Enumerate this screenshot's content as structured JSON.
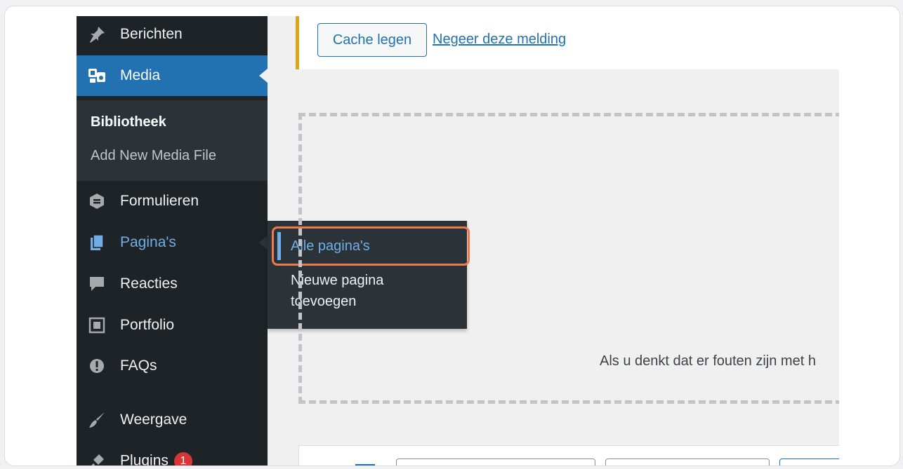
{
  "sidebar": {
    "items": [
      {
        "label": "Berichten",
        "icon": "pin-icon"
      },
      {
        "label": "Media",
        "icon": "media-icon"
      },
      {
        "label": "Formulieren",
        "icon": "forms-icon"
      },
      {
        "label": "Pagina's",
        "icon": "pages-icon"
      },
      {
        "label": "Reacties",
        "icon": "comment-icon"
      },
      {
        "label": "Portfolio",
        "icon": "portfolio-icon"
      },
      {
        "label": "FAQs",
        "icon": "info-icon"
      },
      {
        "label": "Weergave",
        "icon": "brush-icon"
      },
      {
        "label": "Plugins",
        "icon": "plugin-icon",
        "badge": "1"
      }
    ],
    "media_submenu": {
      "library": "Bibliotheek",
      "add_new": "Add New Media File"
    }
  },
  "flyout": {
    "all_pages": "Alle pagina's",
    "new_page_line1": "Nieuwe pagina",
    "new_page_line2": "toevoegen"
  },
  "notice": {
    "button_label": "Cache legen",
    "dismiss_link": "Negeer deze melding"
  },
  "dropzone": {
    "hint": "Als u denkt dat er fouten zijn met h"
  },
  "colors": {
    "sidebar_bg": "#1d2327",
    "active_blue": "#2271b1",
    "highlight_orange": "#ed7a4c",
    "notice_border": "#dba617",
    "badge_red": "#d63638"
  }
}
